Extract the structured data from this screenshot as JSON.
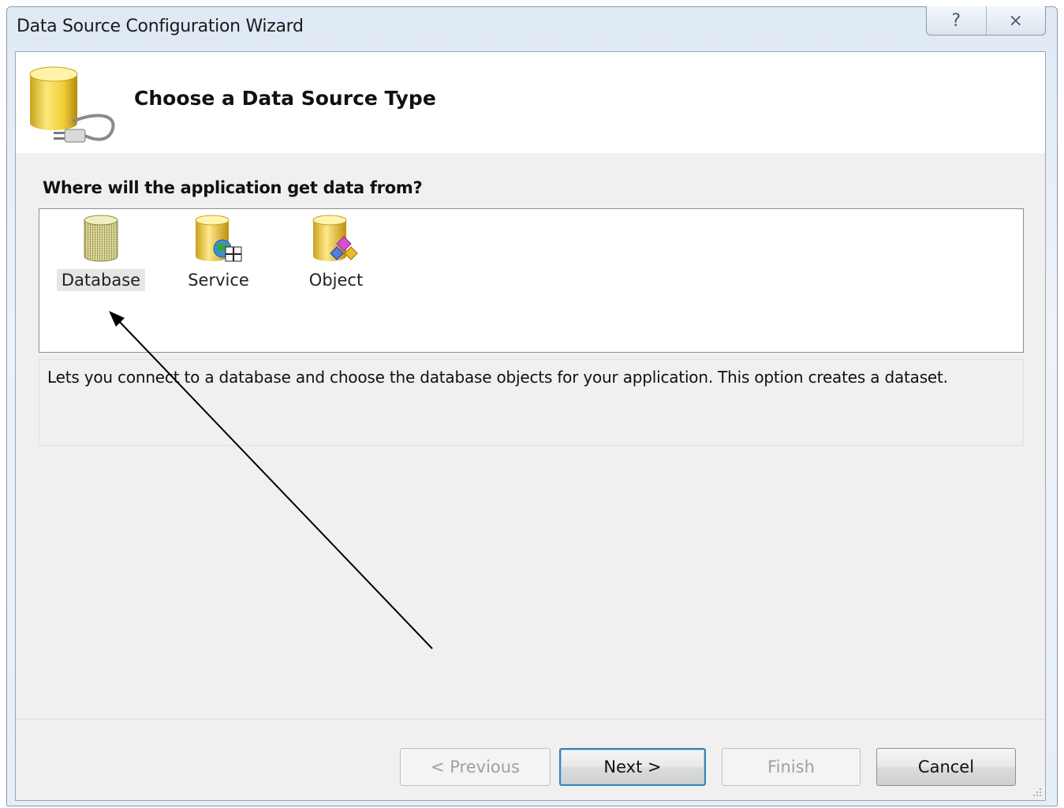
{
  "window": {
    "title": "Data Source Configuration Wizard",
    "help_glyph": "?",
    "close_glyph": "⨯"
  },
  "header": {
    "title": "Choose a Data Source Type",
    "icon": "database-plug-icon"
  },
  "question": "Where will the application get data from?",
  "source_types": [
    {
      "label": "Database",
      "icon": "database-icon",
      "selected": true
    },
    {
      "label": "Service",
      "icon": "service-icon",
      "selected": false
    },
    {
      "label": "Object",
      "icon": "object-icon",
      "selected": false
    }
  ],
  "description": "Lets you connect to a database and choose the database objects for your application. This option creates a dataset.",
  "buttons": {
    "previous": "< Previous",
    "next": "Next >",
    "finish": "Finish",
    "cancel": "Cancel"
  },
  "colors": {
    "default_button_border": "#3c7fb1",
    "selection_background": "#e6e6e6",
    "dialog_background": "#f0f0f0"
  }
}
